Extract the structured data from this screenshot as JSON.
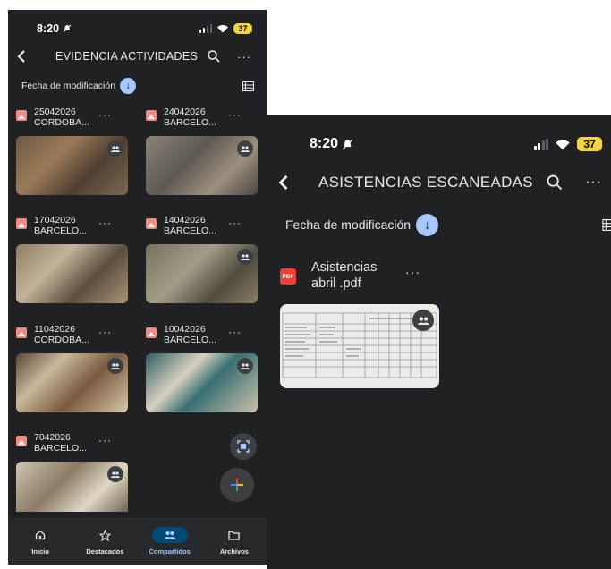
{
  "phone1": {
    "status": {
      "time": "8:20",
      "battery": "37"
    },
    "header": {
      "title": "EVIDENCIA ACTIVIDADES"
    },
    "sort": {
      "label": "Fecha de modificación"
    },
    "files": [
      {
        "line1": "25042026",
        "line2": "CORDOBA..."
      },
      {
        "line1": "24042026",
        "line2": "BARCELO..."
      },
      {
        "line1": "17042026",
        "line2": "BARCELO..."
      },
      {
        "line1": "14042026",
        "line2": "BARCELO..."
      },
      {
        "line1": "11042026",
        "line2": "CORDOBA..."
      },
      {
        "line1": "10042026",
        "line2": "BARCELO..."
      },
      {
        "line1": "7042026",
        "line2": "BARCELO..."
      }
    ],
    "nav": [
      {
        "label": "Inicio",
        "icon": "home-icon"
      },
      {
        "label": "Destacados",
        "icon": "star-icon"
      },
      {
        "label": "Compartidos",
        "icon": "shared-icon"
      },
      {
        "label": "Archivos",
        "icon": "folder-icon"
      }
    ]
  },
  "phone2": {
    "status": {
      "time": "8:20",
      "battery": "37"
    },
    "header": {
      "title": "ASISTENCIAS ESCANEADAS"
    },
    "sort": {
      "label": "Fecha de modificación"
    },
    "file": {
      "line1": "Asistencias",
      "line2": "abril .pdf",
      "type_badge": "PDF"
    }
  },
  "colors": {
    "background": "#202124",
    "accent": "#a8c7fa",
    "image_icon": "#f28b82",
    "battery": "#f5d442"
  }
}
